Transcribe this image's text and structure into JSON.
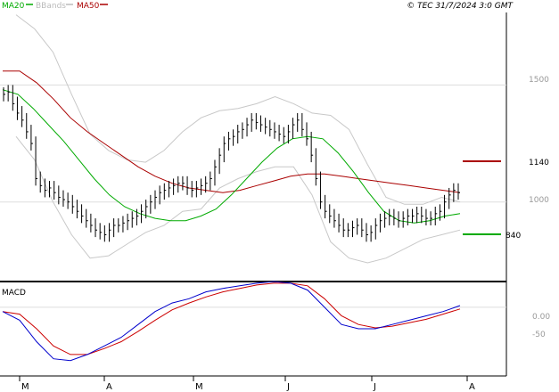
{
  "header": {
    "legend": [
      {
        "label": "MA20",
        "color": "#00aa00"
      },
      {
        "label": "BBands",
        "color": "#bbbbbb"
      },
      {
        "label": "MA50",
        "color": "#aa0000"
      }
    ],
    "copyright": "© TEC 31/7/2024 3:0 GMT"
  },
  "colors": {
    "price": "#000000",
    "ma20": "#00aa00",
    "ma50": "#aa0000",
    "bbands": "#c8c8c8",
    "macd": "#0000cc",
    "signal": "#cc0000",
    "grid": "#dddddd"
  },
  "price_panel": {
    "y_ticks": [
      {
        "value": 1500,
        "label": "1500"
      },
      {
        "value": 1000,
        "label": "1000"
      }
    ],
    "annotations": [
      {
        "value": 1140,
        "label": "1140",
        "color": "#aa0000"
      },
      {
        "value": 840,
        "label": "840",
        "color": "#00aa00"
      }
    ]
  },
  "macd_panel": {
    "label": "MACD",
    "y_ticks": [
      {
        "value": 0,
        "label": "0.00"
      },
      {
        "value": -50,
        "label": "-50"
      }
    ]
  },
  "x_axis": {
    "labels": [
      "M",
      "A",
      "M",
      "J",
      "J",
      "A"
    ]
  },
  "chart_data": [
    {
      "type": "line",
      "title": "",
      "ylim": [
        660,
        1810
      ],
      "x_label_months": [
        "M",
        "A",
        "M",
        "J",
        "J",
        "A"
      ],
      "series": [
        {
          "name": "Price",
          "kind": "ohlc-close",
          "values": [
            1460,
            1470,
            1420,
            1380,
            1350,
            1300,
            1250,
            1100,
            1070,
            1050,
            1060,
            1040,
            1020,
            1010,
            1000,
            980,
            960,
            940,
            920,
            900,
            880,
            870,
            860,
            880,
            900,
            900,
            910,
            920,
            930,
            940,
            960,
            980,
            1000,
            1020,
            1040,
            1050,
            1060,
            1070,
            1080,
            1080,
            1060,
            1050,
            1060,
            1070,
            1080,
            1100,
            1150,
            1200,
            1250,
            1270,
            1280,
            1300,
            1310,
            1330,
            1350,
            1340,
            1330,
            1320,
            1310,
            1300,
            1290,
            1280,
            1300,
            1330,
            1350,
            1310,
            1270,
            1200,
            1100,
            1000,
            960,
            940,
            920,
            900,
            880,
            880,
            890,
            900,
            880,
            860,
            870,
            900,
            920,
            930,
            940,
            930,
            920,
            930,
            940,
            940,
            950,
            940,
            930,
            930,
            950,
            960,
            1000,
            1030,
            1050,
            1040
          ]
        },
        {
          "name": "MA20",
          "values": [
            1480,
            1460,
            1400,
            1330,
            1260,
            1180,
            1100,
            1030,
            980,
            950,
            930,
            920,
            920,
            940,
            970,
            1030,
            1100,
            1170,
            1230,
            1270,
            1280,
            1270,
            1210,
            1130,
            1040,
            960,
            920,
            910,
            920,
            940,
            950
          ]
        },
        {
          "name": "MA50",
          "values": [
            1560,
            1560,
            1510,
            1440,
            1360,
            1300,
            1250,
            1200,
            1150,
            1110,
            1080,
            1060,
            1050,
            1040,
            1050,
            1070,
            1090,
            1110,
            1120,
            1120,
            1110,
            1100,
            1090,
            1080,
            1070,
            1060,
            1050,
            1040
          ]
        },
        {
          "name": "BBands upper",
          "values": [
            1800,
            1740,
            1640,
            1460,
            1290,
            1220,
            1180,
            1170,
            1220,
            1300,
            1360,
            1390,
            1400,
            1420,
            1450,
            1420,
            1380,
            1370,
            1310,
            1160,
            1020,
            990,
            990,
            1020,
            1000
          ]
        },
        {
          "name": "BBands lower",
          "values": [
            1280,
            1180,
            1000,
            860,
            760,
            770,
            820,
            870,
            900,
            960,
            970,
            1060,
            1100,
            1130,
            1150,
            1150,
            1030,
            830,
            760,
            740,
            760,
            800,
            840,
            860,
            880
          ]
        }
      ]
    },
    {
      "type": "line",
      "title": "MACD",
      "ylim": [
        -80,
        30
      ],
      "series": [
        {
          "name": "MACD",
          "values": [
            -5,
            -15,
            -40,
            -60,
            -62,
            -55,
            -45,
            -35,
            -20,
            -5,
            5,
            10,
            18,
            22,
            25,
            28,
            30,
            28,
            20,
            0,
            -20,
            -25,
            -25,
            -20,
            -15,
            -10,
            -5,
            2
          ]
        },
        {
          "name": "Signal",
          "values": [
            -5,
            -8,
            -25,
            -45,
            -55,
            -55,
            -48,
            -40,
            -28,
            -15,
            -3,
            5,
            12,
            18,
            22,
            26,
            28,
            28,
            25,
            10,
            -10,
            -20,
            -24,
            -22,
            -18,
            -14,
            -8,
            -2
          ]
        }
      ]
    }
  ]
}
